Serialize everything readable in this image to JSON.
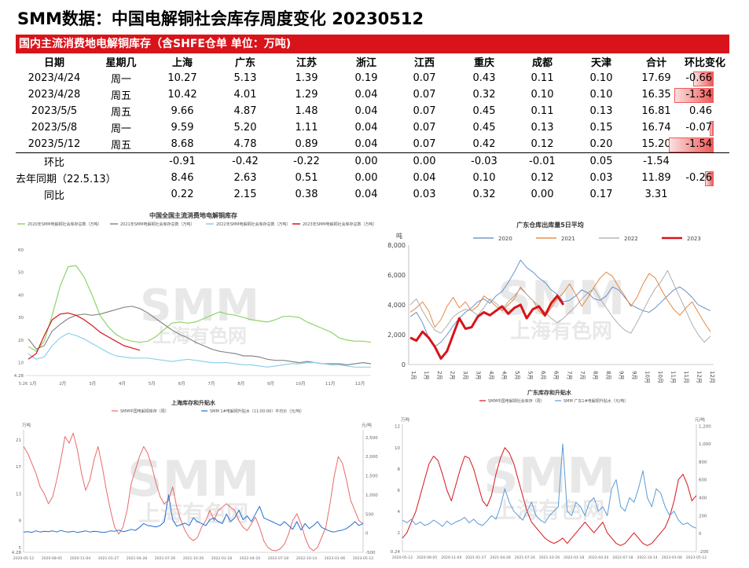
{
  "page_title": "SMM数据：中国电解铜社会库存周度变化 20230512",
  "table": {
    "banner": "国内主流消费地电解铜库存（含SHFE仓单 单位：万吨)",
    "headers": [
      "日期",
      "星期几",
      "上海",
      "广东",
      "江苏",
      "浙江",
      "江西",
      "重庆",
      "成都",
      "天津",
      "合计",
      "环比变化"
    ],
    "rows": [
      [
        "2023/4/24",
        "周一",
        "10.27",
        "5.13",
        "1.39",
        "0.19",
        "0.07",
        "0.43",
        "0.11",
        "0.10",
        "17.69",
        "-0.66"
      ],
      [
        "2023/4/28",
        "周五",
        "10.42",
        "4.01",
        "1.29",
        "0.04",
        "0.07",
        "0.32",
        "0.10",
        "0.10",
        "16.35",
        "-1.34"
      ],
      [
        "2023/5/5",
        "周五",
        "9.66",
        "4.87",
        "1.48",
        "0.04",
        "0.07",
        "0.45",
        "0.11",
        "0.13",
        "16.81",
        "0.46"
      ],
      [
        "2023/5/8",
        "周一",
        "9.59",
        "5.20",
        "1.11",
        "0.04",
        "0.07",
        "0.45",
        "0.13",
        "0.15",
        "16.74",
        "-0.07"
      ],
      [
        "2023/5/12",
        "周五",
        "8.68",
        "4.78",
        "0.89",
        "0.04",
        "0.07",
        "0.42",
        "0.12",
        "0.20",
        "15.20",
        "-1.54"
      ],
      [
        "环比",
        "",
        "-0.91",
        "-0.42",
        "-0.22",
        "0.00",
        "0.00",
        "-0.03",
        "-0.01",
        "0.05",
        "-1.54",
        ""
      ],
      [
        "去年同期（22.5.13）",
        "",
        "8.46",
        "2.63",
        "0.51",
        "0.00",
        "0.04",
        "0.10",
        "0.12",
        "0.03",
        "11.89",
        "-0.26"
      ],
      [
        "同比",
        "",
        "0.22",
        "2.15",
        "0.38",
        "0.04",
        "0.03",
        "0.32",
        "0.00",
        "0.17",
        "3.31",
        ""
      ]
    ],
    "change_values": [
      -0.66,
      -1.34,
      0.46,
      -0.07,
      -1.54,
      null,
      -0.26,
      null
    ],
    "bar_colors": {
      "negative": "#f05a5a",
      "positive": "#6f97d6"
    }
  },
  "watermark": {
    "main": "SMM",
    "sub": "上海有色网"
  },
  "chart_data": [
    {
      "type": "line",
      "title": "中国全国主流消费地电解铜库存",
      "x_ticks": [
        "1月",
        "2月",
        "3月",
        "4月",
        "5月",
        "6月",
        "7月",
        "8月",
        "9月",
        "10月",
        "11月",
        "12月"
      ],
      "y_ticks": [
        "10",
        "20",
        "30",
        "40",
        "50",
        "60"
      ],
      "y_min_label": "4.28",
      "ylim": [
        4.28,
        60
      ],
      "x_start_label": "5.26",
      "series": [
        {
          "name": "2020年SMM电解铜社会库存总数（万吨）",
          "color": "#8fd36c",
          "values": [
            17.2,
            15.0,
            19.5,
            31.0,
            44.0,
            52.5,
            53.0,
            48.0,
            40.0,
            31.0,
            26.0,
            22.5,
            20.5,
            19.5,
            19.0,
            19.5,
            21.5,
            24.5,
            27.5,
            28.0,
            27.5,
            28.0,
            29.5,
            31.0,
            32.5,
            31.5,
            31.0,
            30.0,
            29.0,
            28.5,
            28.0,
            29.0,
            30.5,
            30.5,
            30.0,
            28.0,
            26.5,
            25.0,
            23.5,
            21.0,
            20.0,
            19.5,
            19.5,
            19.0
          ]
        },
        {
          "name": "2021年SMM电解铜社会库存总数（万吨）",
          "color": "#888888",
          "values": [
            20.5,
            16.0,
            17.5,
            24.0,
            27.0,
            29.5,
            31.0,
            31.5,
            31.0,
            31.5,
            32.5,
            33.5,
            34.5,
            35.0,
            34.0,
            32.0,
            29.5,
            27.0,
            24.5,
            22.5,
            21.0,
            19.0,
            17.5,
            16.0,
            15.0,
            14.5,
            14.0,
            13.0,
            13.0,
            12.5,
            11.5,
            11.0,
            11.0,
            10.5,
            10.0,
            10.5,
            10.0,
            9.5,
            9.5,
            9.5,
            9.0,
            9.5,
            10.0,
            9.5
          ]
        },
        {
          "name": "2022年SMM电解铜社会库存总数（万吨）",
          "color": "#8ed0ec",
          "values": [
            14.0,
            11.5,
            12.5,
            17.5,
            21.0,
            23.0,
            22.0,
            20.5,
            18.5,
            16.5,
            14.5,
            13.0,
            12.5,
            12.0,
            12.0,
            12.0,
            11.5,
            11.0,
            10.5,
            11.0,
            11.5,
            11.0,
            10.5,
            10.0,
            10.0,
            10.0,
            9.5,
            9.0,
            9.0,
            8.5,
            8.0,
            8.5,
            9.0,
            9.5,
            9.5,
            10.0,
            10.0,
            9.5,
            9.0,
            9.0,
            8.5,
            8.0,
            8.0,
            8.0
          ]
        },
        {
          "name": "2023年SMM电解铜社会库存总数（万吨）",
          "color": "#d6141a",
          "values": [
            11.5,
            14.0,
            22.0,
            29.0,
            31.5,
            32.0,
            31.0,
            29.0,
            26.5,
            23.5,
            21.5,
            19.5,
            17.5,
            16.5,
            15.5
          ]
        }
      ]
    },
    {
      "type": "line",
      "title": "广东仓库出库量5日平均",
      "ylabel": "吨",
      "y_ticks": [
        "0",
        "2,000",
        "4,000",
        "6,000",
        "8,000"
      ],
      "ylim": [
        0,
        8000
      ],
      "x_ticks": [
        "1月",
        "1月",
        "2月",
        "2月",
        "3月",
        "3月",
        "4月",
        "4月",
        "5月",
        "5月",
        "6月",
        "6月",
        "7月",
        "7月",
        "8月",
        "8月",
        "9月",
        "9月",
        "10月",
        "10月",
        "11月",
        "11月",
        "12月",
        "12月"
      ],
      "series": [
        {
          "name": "2020",
          "color": "#5b86c7",
          "values": [
            3200,
            3500,
            2800,
            1800,
            1200,
            1500,
            2000,
            2600,
            3100,
            3500,
            3800,
            4200,
            4400,
            4100,
            4600,
            4900,
            5500,
            6200,
            7000,
            6500,
            6200,
            5800,
            5500,
            5000,
            4700,
            4200,
            4300,
            4600,
            5000,
            4800,
            4400,
            4300,
            4600,
            5200,
            5000,
            4500,
            4000,
            3800,
            3600,
            3500,
            3800,
            4200,
            4600,
            5000,
            5200,
            4900,
            4500,
            4000,
            3800,
            3600
          ]
        },
        {
          "name": "2021",
          "color": "#e57b2c",
          "values": [
            3500,
            3800,
            4200,
            3600,
            2500,
            3000,
            3900,
            4500,
            3800,
            4200,
            3600,
            3900,
            4600,
            4300,
            3900,
            3600,
            4000,
            4400,
            5200,
            4700,
            4300,
            3600,
            3200,
            3800,
            4400,
            4800,
            5400,
            4700,
            3900,
            4500,
            5200,
            5800,
            6200,
            5900,
            5200,
            4600,
            3900,
            4500,
            5400,
            6100,
            5800,
            5000,
            4300,
            3700,
            3300,
            3800,
            4200,
            3500,
            2800,
            2200
          ]
        },
        {
          "name": "2022",
          "color": "#a6a6a6",
          "values": [
            4000,
            4400,
            3600,
            2900,
            2300,
            2100,
            2600,
            3200,
            3500,
            3700,
            3600,
            3300,
            3800,
            4400,
            4100,
            3700,
            4200,
            4600,
            5100,
            4700,
            4300,
            3900,
            3500,
            3100,
            2800,
            3100,
            3500,
            3900,
            4400,
            4800,
            5100,
            4400,
            3800,
            3200,
            2700,
            2300,
            2100,
            2800,
            3600,
            4400,
            5100,
            5600,
            6300,
            5400,
            4500,
            3600,
            2700,
            2000,
            1500,
            1900
          ]
        },
        {
          "name": "2023",
          "color": "#d6141a",
          "values": [
            1800,
            1600,
            2200,
            1800,
            1200,
            400,
            900,
            2000,
            3100,
            2400,
            2500,
            3200,
            3500,
            3300,
            3600,
            3900,
            3400,
            3800,
            4000,
            3100,
            3700,
            3900,
            3300,
            4100,
            4600,
            4000
          ]
        }
      ]
    },
    {
      "type": "line",
      "title": "上海库存和升贴水",
      "ylabel_left": "万吨",
      "ylabel_right": "元/吨",
      "y_ticks_left": [
        "4.28",
        "5",
        "9",
        "13",
        "17",
        "21"
      ],
      "y_ticks_right": [
        "-500",
        "0",
        "500",
        "1,000",
        "1,500",
        "2,000",
        "2,500"
      ],
      "x_ticks": [
        "2020-05-12",
        "2020-08-05",
        "2020-11-04",
        "2021-01-27",
        "2021-04-28",
        "2021-07-26",
        "2021-10-26",
        "2022-01-18",
        "2022-04-20",
        "2022-07-18",
        "2022-10-14",
        "2023-01-06",
        "2023-05-12"
      ],
      "series": [
        {
          "name": "SMM中国电解铜库存（周）",
          "axis": "left",
          "color": "#e86a6a",
          "values": [
            20.0,
            19.0,
            17.5,
            16.0,
            14.0,
            13.0,
            11.5,
            12.5,
            15.0,
            18.0,
            21.5,
            20.5,
            22.0,
            19.5,
            16.0,
            13.5,
            15.0,
            18.0,
            20.0,
            17.0,
            13.5,
            10.5,
            8.0,
            7.0,
            8.0,
            10.5,
            14.5,
            16.5,
            18.5,
            20.0,
            19.0,
            17.0,
            14.5,
            12.5,
            11.5,
            12.0,
            14.0,
            11.0,
            9.0,
            7.5,
            6.5,
            6.0,
            6.5,
            8.0,
            9.0,
            10.5,
            9.0,
            10.5,
            11.0,
            11.5,
            11.0,
            10.5,
            9.0,
            8.0,
            7.5,
            8.5,
            9.5,
            8.0,
            6.0,
            5.0,
            4.6,
            4.5,
            4.8,
            5.5,
            7.0,
            9.0,
            10.0,
            8.5,
            6.5,
            5.0,
            4.5,
            5.0,
            6.5,
            8.0,
            11.5,
            15.5,
            18.5,
            17.5,
            15.0,
            12.0,
            10.5,
            9.0,
            8.5
          ]
        },
        {
          "name": "SMM 1#电解铜升贴水（11:00:00）平均价（元/吨）",
          "axis": "right",
          "color": "#1f6fd0",
          "values": [
            30,
            40,
            20,
            60,
            30,
            50,
            40,
            60,
            30,
            70,
            40,
            30,
            50,
            20,
            40,
            60,
            30,
            50,
            40,
            20,
            30,
            60,
            50,
            80,
            40,
            60,
            100,
            70,
            150,
            250,
            200,
            180,
            160,
            200,
            300,
            1000,
            350,
            180,
            220,
            260,
            200,
            400,
            300,
            250,
            200,
            350,
            400,
            300,
            250,
            500,
            300,
            400,
            600,
            350,
            450,
            300,
            500,
            700,
            400,
            350,
            300,
            250,
            200,
            300,
            200,
            100,
            300,
            80,
            250,
            120,
            200,
            300,
            150,
            100,
            50,
            30,
            60,
            80,
            120,
            200,
            300,
            200,
            250
          ]
        }
      ]
    },
    {
      "type": "line",
      "title": "广东库存和升贴水",
      "ylabel_left": "万吨",
      "ylabel_right": "元/吨",
      "y_ticks_left": [
        "0.24",
        "2",
        "4",
        "6",
        "8",
        "10",
        "12"
      ],
      "y_ticks_right": [
        "-200",
        "0",
        "200",
        "400",
        "600",
        "800",
        "1,000",
        "1,200"
      ],
      "x_ticks": [
        "2020-05-12",
        "2020-08-05",
        "2020-11-04",
        "2021-01-27",
        "2021-04-28",
        "2021-07-26",
        "2021-10-26",
        "2022-01-18",
        "2022-04-20",
        "2022-07-18",
        "2022-10-14",
        "2023-01-06",
        "2023-05-12"
      ],
      "series": [
        {
          "name": "SMM中国电解铜社会库存（周）",
          "axis": "left",
          "color": "#d6141a",
          "values": [
            1.5,
            2.0,
            3.0,
            4.0,
            5.5,
            7.0,
            8.5,
            9.2,
            8.8,
            7.5,
            6.0,
            5.0,
            6.5,
            8.0,
            9.2,
            9.0,
            8.0,
            6.5,
            5.0,
            4.5,
            5.5,
            7.5,
            9.0,
            10.0,
            9.5,
            8.5,
            7.0,
            5.5,
            4.0,
            3.0,
            2.5,
            2.0,
            1.5,
            1.2,
            1.0,
            1.2,
            1.5,
            1.0,
            1.5,
            2.0,
            2.5,
            3.0,
            2.5,
            2.0,
            2.5,
            3.0,
            2.0,
            1.5,
            1.0,
            0.8,
            1.0,
            1.5,
            2.0,
            1.5,
            1.0,
            0.8,
            1.0,
            1.5,
            2.0,
            2.5,
            3.5,
            5.0,
            7.0,
            7.5,
            6.5,
            5.0,
            5.5
          ]
        },
        {
          "name": "SMM 广东1#电解铜升贴水（元/吨）",
          "axis": "right",
          "color": "#5b9bd5",
          "values": [
            150,
            120,
            160,
            100,
            130,
            90,
            110,
            150,
            120,
            80,
            140,
            100,
            130,
            150,
            180,
            120,
            160,
            110,
            90,
            140,
            200,
            160,
            300,
            500,
            350,
            250,
            200,
            150,
            250,
            350,
            200,
            150,
            120,
            200,
            250,
            300,
            1000,
            250,
            200,
            350,
            300,
            200,
            350,
            400,
            250,
            300,
            200,
            500,
            600,
            300,
            250,
            400,
            350,
            500,
            700,
            400,
            300,
            500,
            450,
            300,
            200,
            250,
            150,
            100,
            120,
            80,
            60
          ]
        }
      ]
    }
  ]
}
